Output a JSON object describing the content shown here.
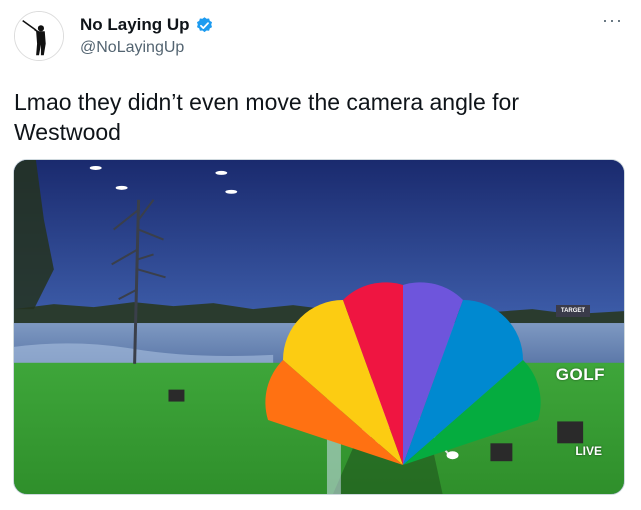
{
  "tweet": {
    "display_name": "No Laying Up",
    "handle": "@NoLayingUp",
    "text": "Lmao they didn’t even move the camera angle for Westwood",
    "more_icon": "···",
    "verified_icon": "verified-badge-icon",
    "verified_color": "#1d9bf0"
  },
  "media": {
    "live_label": "LIVE",
    "network_label": "GOLF",
    "sign_label": "TARGET"
  }
}
